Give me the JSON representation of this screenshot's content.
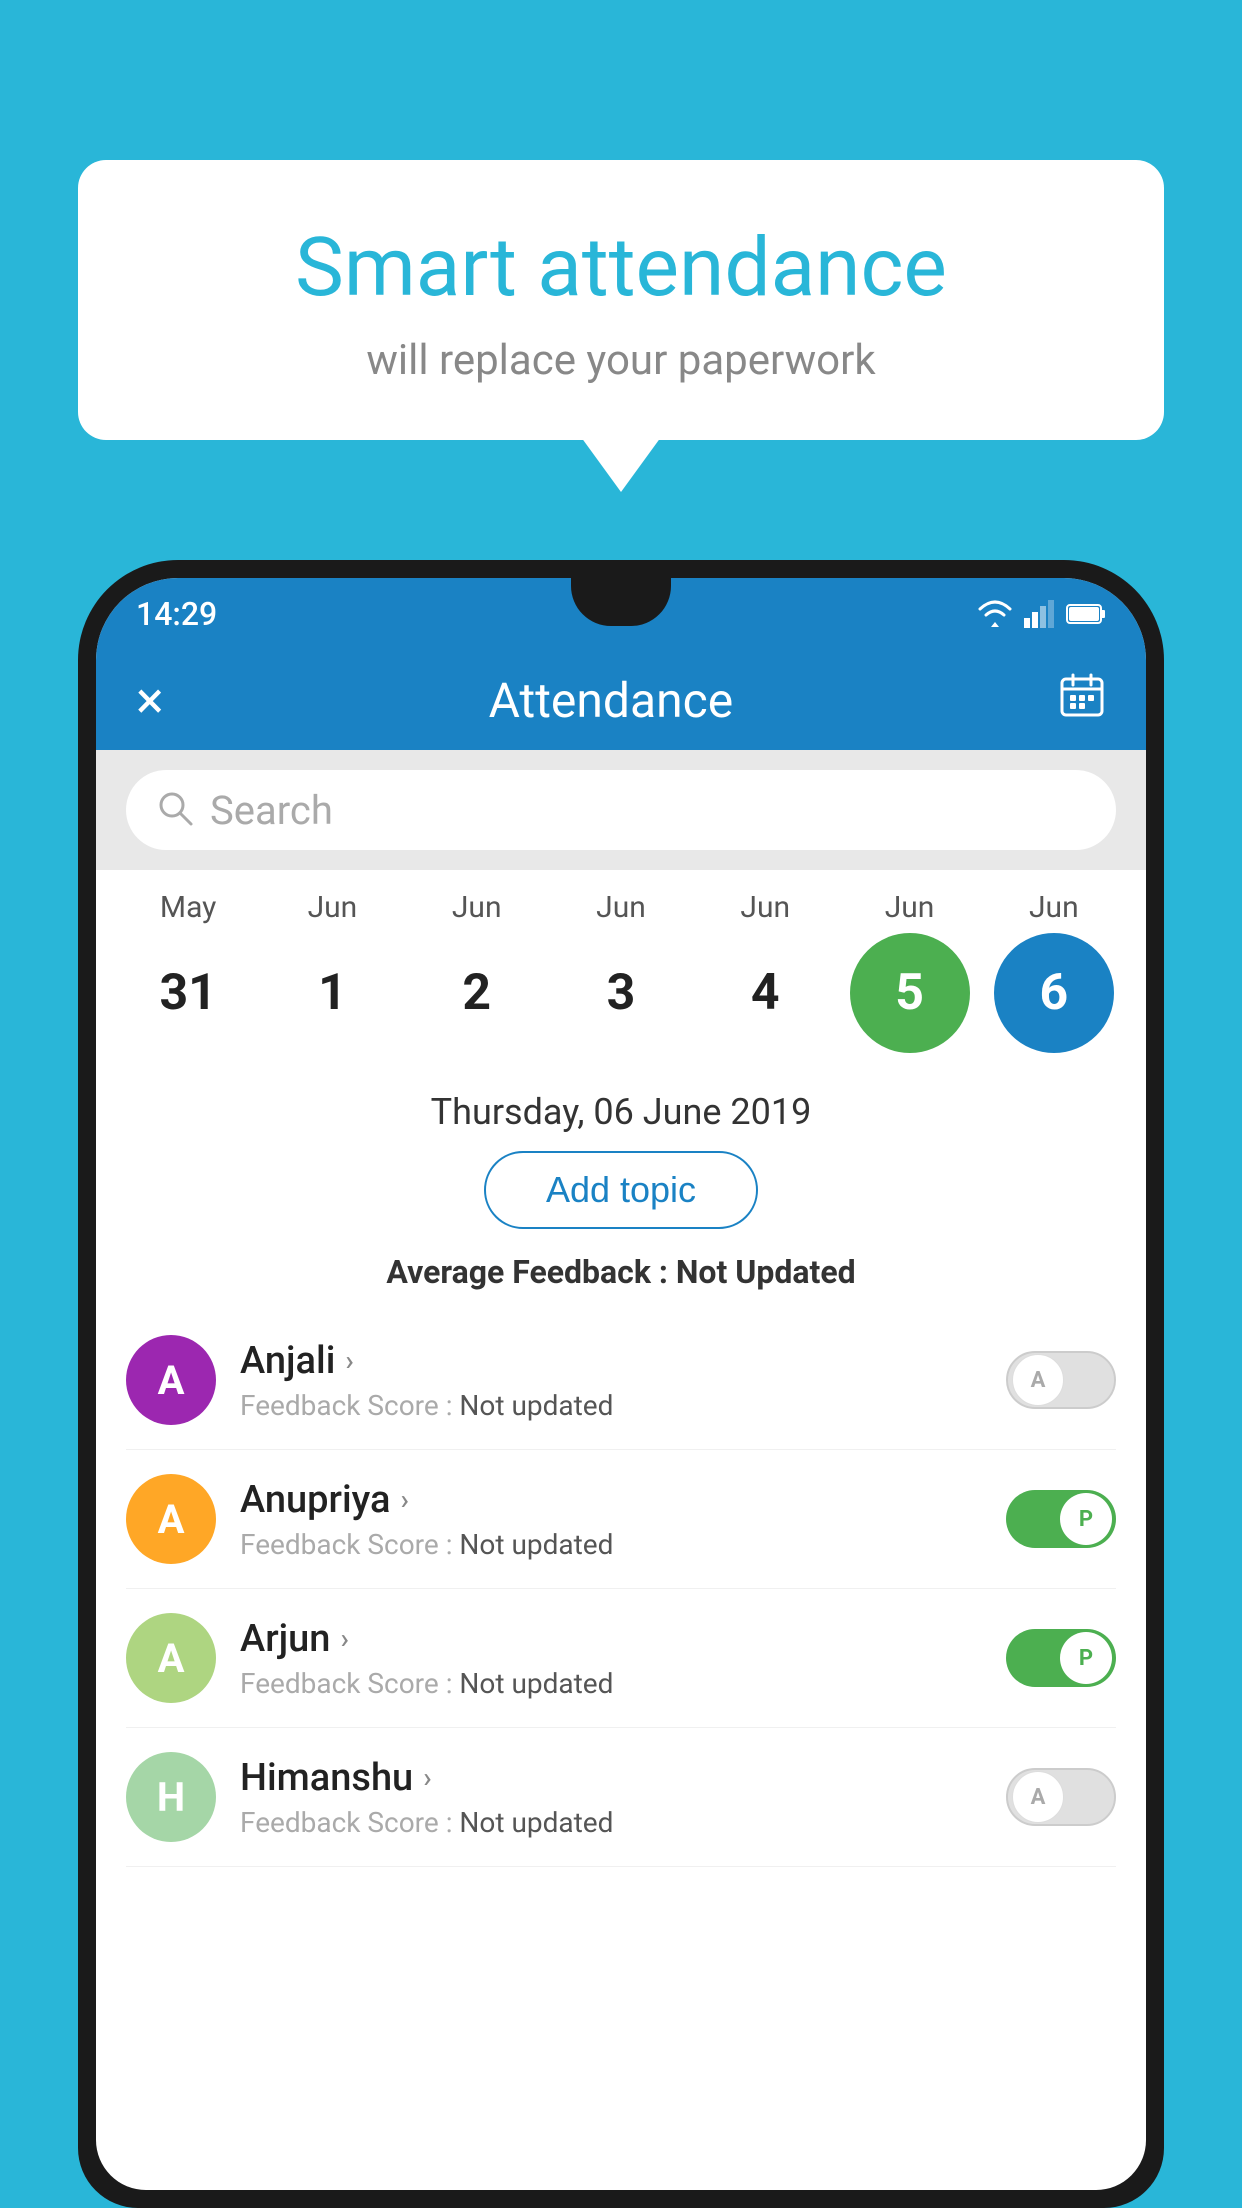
{
  "page": {
    "background_color": "#29b6d8"
  },
  "bubble": {
    "title": "Smart attendance",
    "subtitle": "will replace your paperwork"
  },
  "status_bar": {
    "time": "14:29"
  },
  "header": {
    "title": "Attendance",
    "close_label": "×",
    "calendar_label": "📅"
  },
  "search": {
    "placeholder": "Search"
  },
  "calendar": {
    "months": [
      "May",
      "Jun",
      "Jun",
      "Jun",
      "Jun",
      "Jun",
      "Jun"
    ],
    "dates": [
      "31",
      "1",
      "2",
      "3",
      "4",
      "5",
      "6"
    ],
    "states": [
      "normal",
      "normal",
      "normal",
      "normal",
      "normal",
      "today",
      "selected"
    ]
  },
  "selected_date": {
    "label": "Thursday, 06 June 2019"
  },
  "add_topic": {
    "label": "Add topic"
  },
  "avg_feedback": {
    "label": "Average Feedback : ",
    "value": "Not Updated"
  },
  "students": [
    {
      "name": "Anjali",
      "initial": "A",
      "avatar_color": "#9c27b0",
      "feedback_label": "Feedback Score : ",
      "feedback_value": "Not updated",
      "toggle_state": "off",
      "toggle_label": "A"
    },
    {
      "name": "Anupriya",
      "initial": "A",
      "avatar_color": "#ffa726",
      "feedback_label": "Feedback Score : ",
      "feedback_value": "Not updated",
      "toggle_state": "on",
      "toggle_label": "P"
    },
    {
      "name": "Arjun",
      "initial": "A",
      "avatar_color": "#aed581",
      "feedback_label": "Feedback Score : ",
      "feedback_value": "Not updated",
      "toggle_state": "on",
      "toggle_label": "P"
    },
    {
      "name": "Himanshu",
      "initial": "H",
      "avatar_color": "#a5d6a7",
      "feedback_label": "Feedback Score : ",
      "feedback_value": "Not updated",
      "toggle_state": "off",
      "toggle_label": "A"
    }
  ]
}
